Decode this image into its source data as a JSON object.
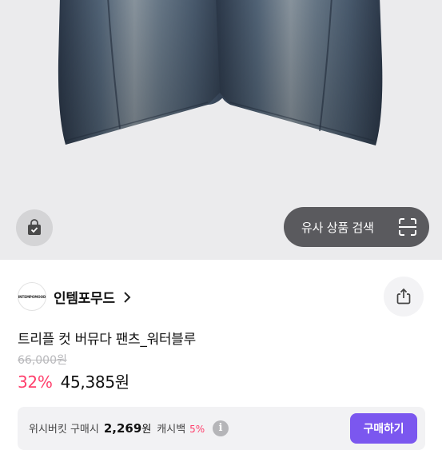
{
  "hero": {
    "image_name": "denim-shorts-product-photo",
    "bag_icon": "shopping-bag-check-icon",
    "similar_search_label": "유사 상품 검색",
    "similar_search_icon": "scan-icon"
  },
  "brand": {
    "logo_text": "INTEMPOMOOD",
    "name": "인템포무드",
    "chevron_icon": "chevron-right-icon",
    "share_icon": "share-icon"
  },
  "product": {
    "title": "트리플 컷 버뮤다 팬츠_워터블루",
    "original_price": "66,000원",
    "discount": "32%",
    "price": "45,385원"
  },
  "promo": {
    "brand": "위시버킷 구매시",
    "amount": "2,269",
    "won": "원",
    "cashback_label": "캐시백",
    "cashback_rate": "5%",
    "info_icon": "i",
    "buy_label": "구매하기"
  },
  "colors": {
    "accent": "#7b57ef",
    "discount": "#ff3f6c"
  }
}
